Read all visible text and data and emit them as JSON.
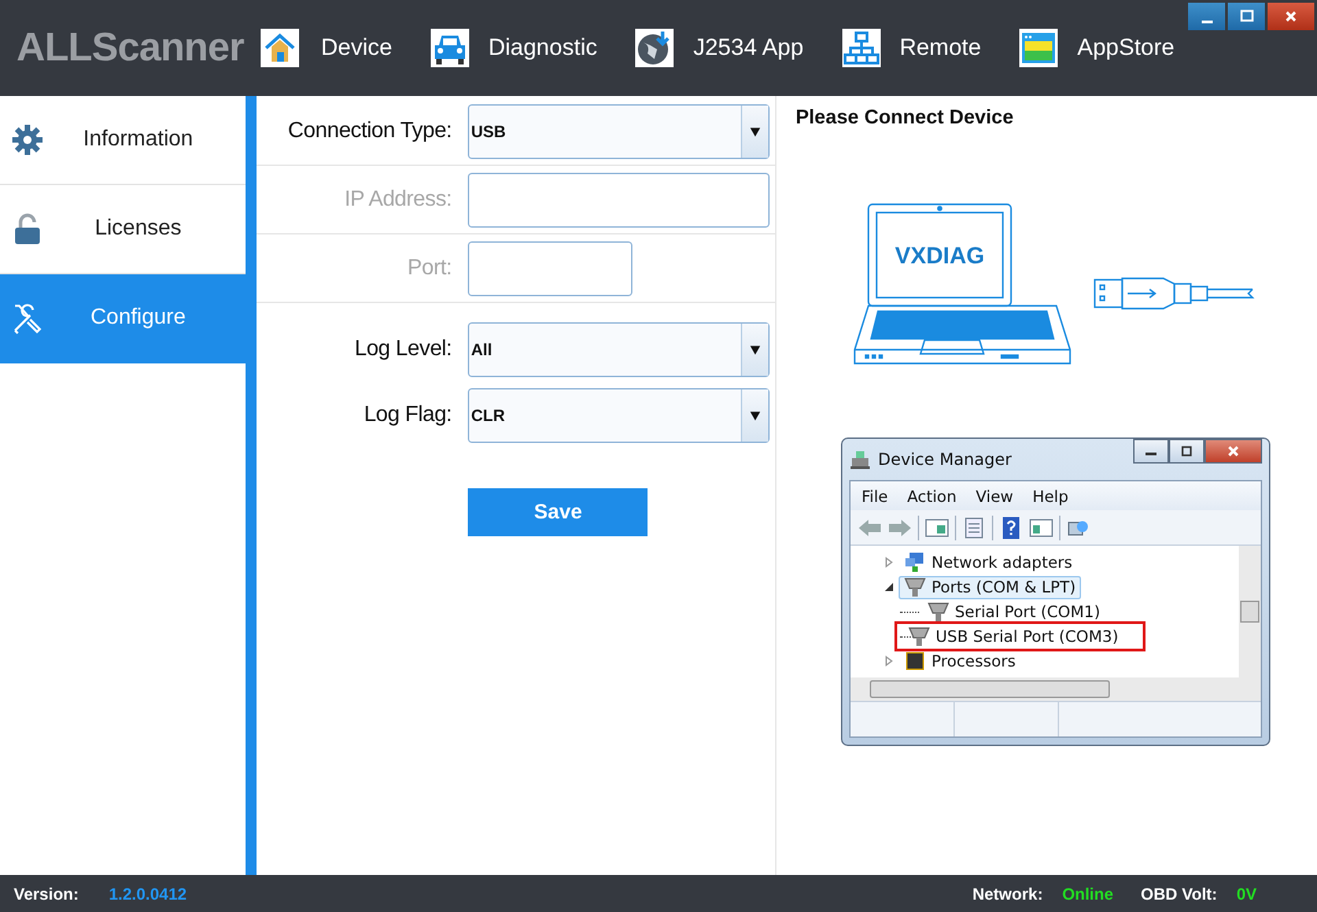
{
  "header": {
    "logo": "ALLScanner",
    "nav": [
      {
        "label": "Device",
        "kind": "house"
      },
      {
        "label": "Diagnostic",
        "kind": "car"
      },
      {
        "label": "J2534 App",
        "kind": "globe"
      },
      {
        "label": "Remote",
        "kind": "network"
      },
      {
        "label": "AppStore",
        "kind": "window"
      }
    ]
  },
  "sidebar": {
    "items": [
      {
        "label": "Information",
        "kind": "gear",
        "selected": false
      },
      {
        "label": "Licenses",
        "kind": "lock",
        "selected": false
      },
      {
        "label": "Configure",
        "kind": "tools",
        "selected": true
      }
    ]
  },
  "form": {
    "sections": [
      {
        "rows": [
          {
            "kind": "select",
            "label": "Connection Type:",
            "value": "USB",
            "disabled": false
          },
          {
            "kind": "text",
            "label": "IP Address:",
            "disabled": true
          },
          {
            "kind": "short-text",
            "label": "Port:",
            "disabled": true
          }
        ]
      },
      {
        "rows": [
          {
            "kind": "select",
            "label": "Log Level:",
            "value": "All",
            "disabled": false
          },
          {
            "kind": "select",
            "label": "Log Flag:",
            "value": "CLR",
            "disabled": false
          }
        ]
      }
    ],
    "save": "Save"
  },
  "device_panel": {
    "title": "Please Connect Device",
    "laptop_text": "VXDIAG",
    "device_manager": {
      "title": "Device Manager",
      "menu": [
        "File",
        "Action",
        "View",
        "Help"
      ],
      "tree": [
        {
          "label": "Network adapters",
          "kind": "network",
          "expanded": false,
          "selected": false,
          "highlighted": false
        },
        {
          "label": "Ports (COM & LPT)",
          "kind": "port",
          "expanded": true,
          "selected": true,
          "highlighted": false,
          "children": [
            {
              "label": "Serial Port (COM1)",
              "kind": "port",
              "selected": false,
              "highlighted": false
            },
            {
              "label": "USB Serial Port (COM3)",
              "kind": "port",
              "selected": false,
              "highlighted": true
            }
          ]
        },
        {
          "label": "Processors",
          "kind": "chip",
          "expanded": false,
          "selected": false,
          "highlighted": false
        }
      ]
    }
  },
  "status_bar": {
    "version_label": "Version:",
    "version": "1.2.0.0412",
    "network_label": "Network:",
    "network": "Online",
    "volt_label": "OBD Volt:",
    "volt": "0V"
  }
}
